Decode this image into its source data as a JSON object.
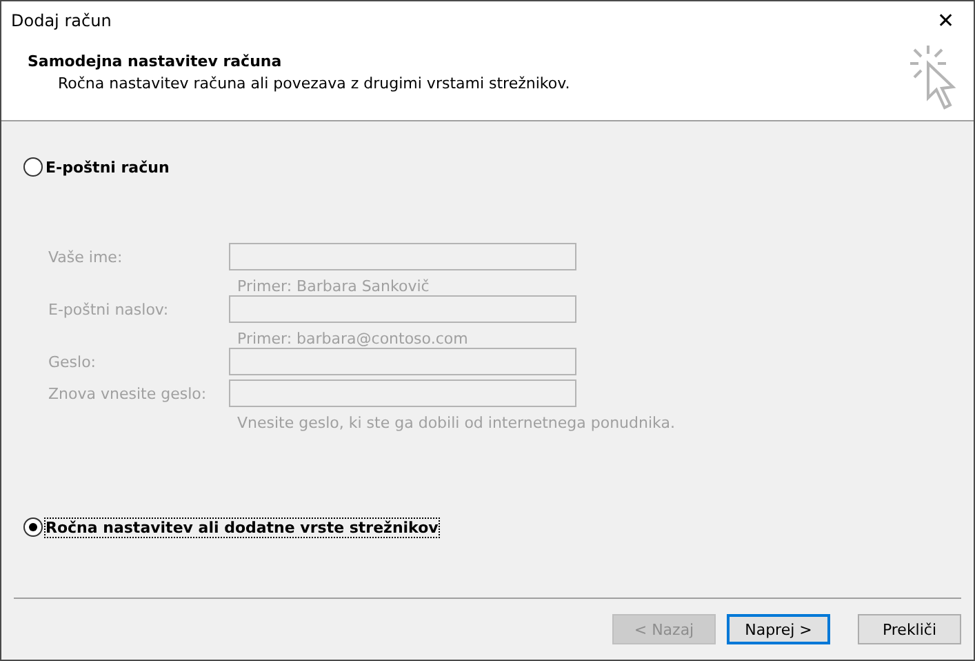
{
  "window": {
    "title": "Dodaj račun",
    "close": "✕"
  },
  "header": {
    "title": "Samodejna nastavitev računa",
    "subtitle": "Ročna nastavitev računa ali povezava z drugimi vrstami strežnikov."
  },
  "options": [
    {
      "label": "E-poštni račun",
      "selected": false,
      "focused": false
    },
    {
      "label": "Ročna nastavitev ali dodatne vrste strežnikov",
      "selected": true,
      "focused": true
    }
  ],
  "fields": [
    {
      "label": "Vaše ime:",
      "hint": "Primer: Barbara Sankovič",
      "disabled": true
    },
    {
      "label": "E-poštni naslov:",
      "hint": "Primer: barbara@contoso.com",
      "disabled": true
    },
    {
      "label": "Geslo:",
      "disabled": true
    },
    {
      "label": "Znova vnesite geslo:",
      "hint": "Vnesite geslo, ki ste ga dobili od internetnega ponudnika.",
      "disabled": true
    }
  ],
  "buttons": [
    {
      "label": "< Nazaj",
      "disabled": true,
      "default": false
    },
    {
      "label": "Naprej >",
      "disabled": false,
      "default": true
    },
    {
      "label": "Prekliči",
      "disabled": false,
      "default": false
    }
  ]
}
